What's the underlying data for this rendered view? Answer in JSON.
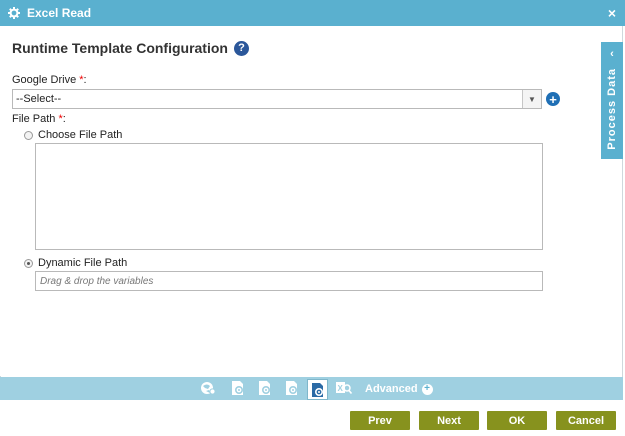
{
  "window": {
    "title": "Excel Read",
    "close_glyph": "×",
    "title_icon": "gear-icon"
  },
  "page": {
    "title": "Runtime Template Configuration",
    "help_glyph": "?"
  },
  "google_drive": {
    "label": "Google Drive",
    "required_mark": "*",
    "colon": ":",
    "selected": "--Select--",
    "add_glyph": "+"
  },
  "file_path": {
    "label": "File Path",
    "required_mark": "*",
    "colon": ":",
    "options": [
      {
        "label": "Choose File Path",
        "selected": false
      },
      {
        "label": "Dynamic File Path",
        "selected": true
      }
    ],
    "dynamic_placeholder": "Drag & drop the variables"
  },
  "side_panel": {
    "label": "Process Data",
    "chevron": "‹"
  },
  "toolstrip": {
    "advanced_label": "Advanced",
    "advanced_glyph": "+",
    "tools": [
      "globe-settings-icon",
      "form-settings-icon",
      "form-settings-icon",
      "form-settings-icon",
      "save-settings-icon",
      "excel-search-icon"
    ],
    "active_index": 4
  },
  "buttons": {
    "prev": "Prev",
    "next": "Next",
    "ok": "OK",
    "cancel": "Cancel"
  },
  "colors": {
    "header": "#5ab0cf",
    "toolstrip": "#9fd0e1",
    "button": "#87921e",
    "required": "#e00000",
    "help": "#2b579a"
  }
}
